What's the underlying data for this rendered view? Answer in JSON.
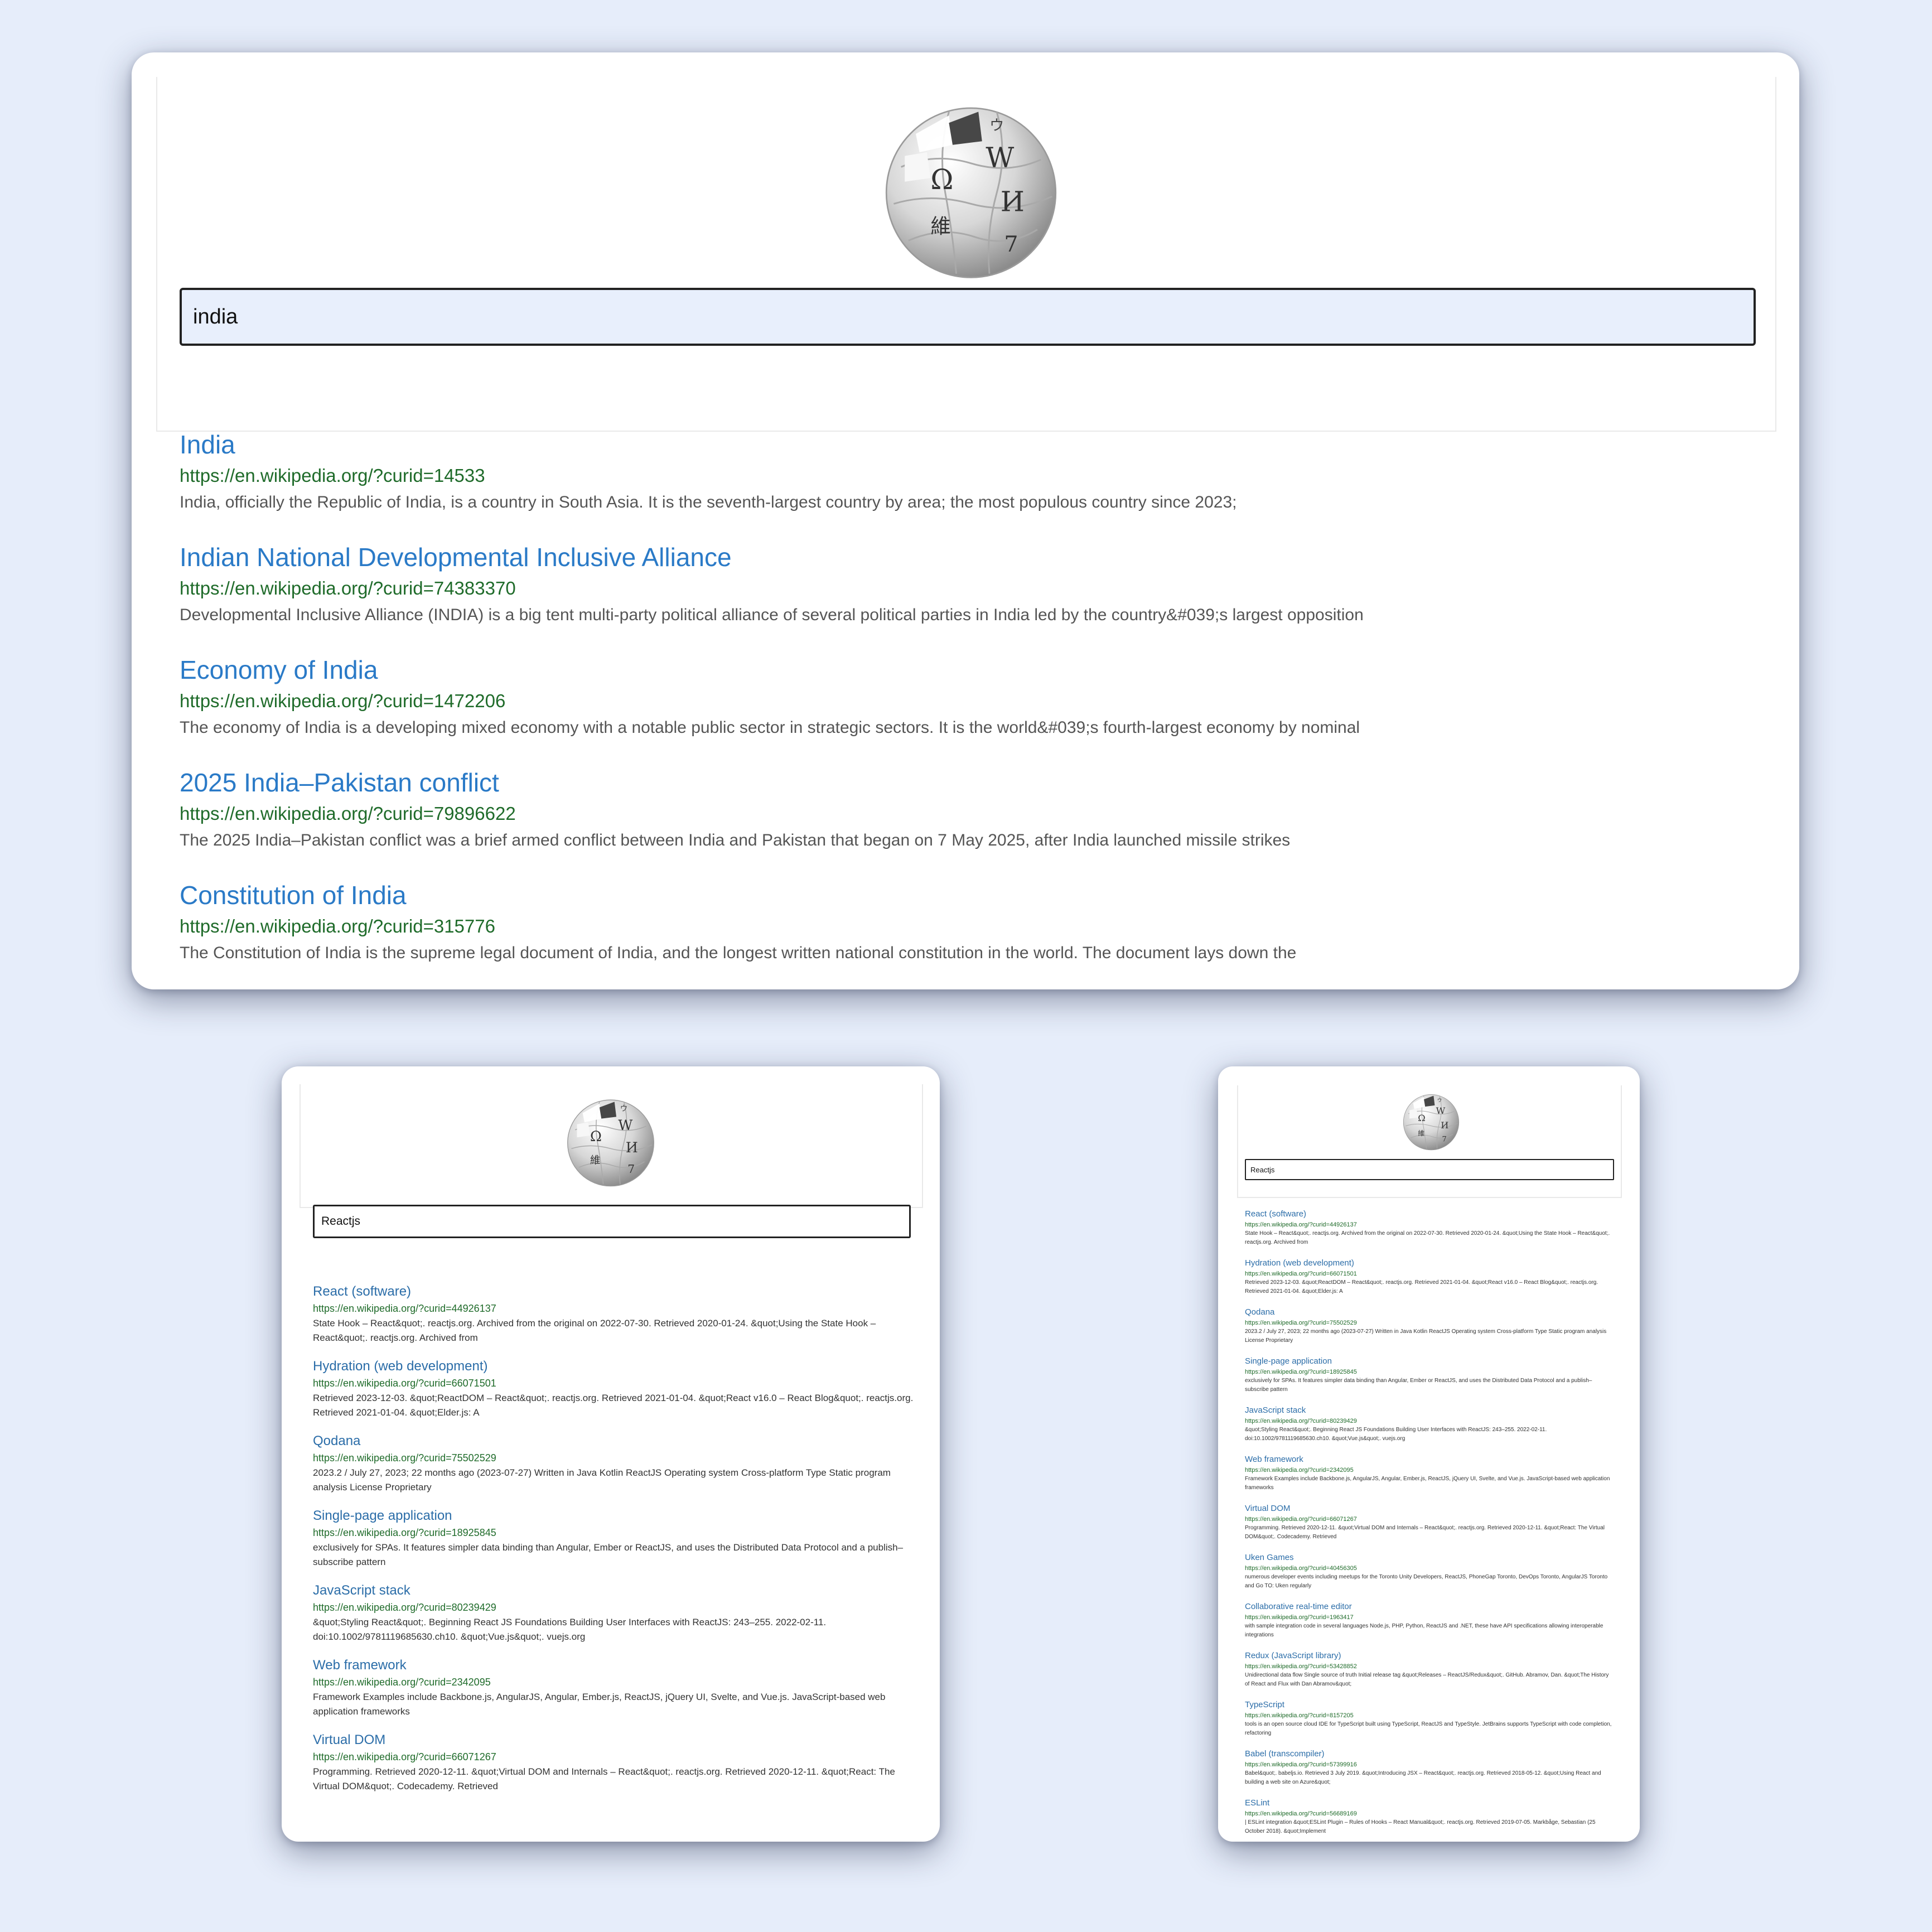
{
  "colors": {
    "background": "#e6edfa",
    "title_link": "#2a7ac7",
    "url": "#1f6b2a",
    "snippet": "#555555",
    "search_bg": "#e8effc"
  },
  "logo_icon": "wikipedia-globe-icon",
  "desktop": {
    "search_value": "india",
    "results": [
      {
        "title": "India",
        "url": "https://en.wikipedia.org/?curid=14533",
        "snippet": "India, officially the Republic of India, is a country in South Asia. It is the seventh-largest country by area; the most populous country since 2023;"
      },
      {
        "title": "Indian National Developmental Inclusive Alliance",
        "url": "https://en.wikipedia.org/?curid=74383370",
        "snippet": "Developmental Inclusive Alliance (INDIA) is a big tent multi-party political alliance of several political parties in India led by the country&#039;s largest opposition"
      },
      {
        "title": "Economy of India",
        "url": "https://en.wikipedia.org/?curid=1472206",
        "snippet": "The economy of India is a developing mixed economy with a notable public sector in strategic sectors. It is the world&#039;s fourth-largest economy by nominal"
      },
      {
        "title": "2025 India–Pakistan conflict",
        "url": "https://en.wikipedia.org/?curid=79896622",
        "snippet": "The 2025 India–Pakistan conflict was a brief armed conflict between India and Pakistan that began on 7 May 2025, after India launched missile strikes"
      },
      {
        "title": "Constitution of India",
        "url": "https://en.wikipedia.org/?curid=315776",
        "snippet": "The Constitution of India is the supreme legal document of India, and the longest written national constitution in the world. The document lays down the"
      }
    ]
  },
  "tablet": {
    "search_value": "Reactjs",
    "results": [
      {
        "title": "React (software)",
        "url": "https://en.wikipedia.org/?curid=44926137",
        "snippet": "State Hook – React&quot;. reactjs.org. Archived from the original on 2022-07-30. Retrieved 2020-01-24. &quot;Using the State Hook – React&quot;. reactjs.org. Archived from"
      },
      {
        "title": "Hydration (web development)",
        "url": "https://en.wikipedia.org/?curid=66071501",
        "snippet": "Retrieved 2023-12-03. &quot;ReactDOM – React&quot;. reactjs.org. Retrieved 2021-01-04. &quot;React v16.0 – React Blog&quot;. reactjs.org. Retrieved 2021-01-04. &quot;Elder.js: A"
      },
      {
        "title": "Qodana",
        "url": "https://en.wikipedia.org/?curid=75502529",
        "snippet": "2023.2 / July 27, 2023; 22 months ago (2023-07-27) Written in Java Kotlin ReactJS Operating system Cross-platform Type Static program analysis License Proprietary"
      },
      {
        "title": "Single-page application",
        "url": "https://en.wikipedia.org/?curid=18925845",
        "snippet": "exclusively for SPAs. It features simpler data binding than Angular, Ember or ReactJS, and uses the Distributed Data Protocol and a publish–subscribe pattern"
      },
      {
        "title": "JavaScript stack",
        "url": "https://en.wikipedia.org/?curid=80239429",
        "snippet": "&quot;Styling React&quot;. Beginning React JS Foundations Building User Interfaces with ReactJS: 243–255. 2022-02-11. doi:10.1002/9781119685630.ch10. &quot;Vue.js&quot;. vuejs.org"
      },
      {
        "title": "Web framework",
        "url": "https://en.wikipedia.org/?curid=2342095",
        "snippet": "Framework Examples include Backbone.js, AngularJS, Angular, Ember.js, ReactJS, jQuery UI, Svelte, and Vue.js. JavaScript-based web application frameworks"
      },
      {
        "title": "Virtual DOM",
        "url": "https://en.wikipedia.org/?curid=66071267",
        "snippet": "Programming. Retrieved 2020-12-11. &quot;Virtual DOM and Internals – React&quot;. reactjs.org. Retrieved 2020-12-11. &quot;React: The Virtual DOM&quot;. Codecademy. Retrieved"
      }
    ]
  },
  "mobile": {
    "search_value": "Reactjs",
    "results": [
      {
        "title": "React (software)",
        "url": "https://en.wikipedia.org/?curid=44926137",
        "snippet": "State Hook – React&quot;. reactjs.org. Archived from the original on 2022-07-30. Retrieved 2020-01-24. &quot;Using the State Hook – React&quot;. reactjs.org. Archived from"
      },
      {
        "title": "Hydration (web development)",
        "url": "https://en.wikipedia.org/?curid=66071501",
        "snippet": "Retrieved 2023-12-03. &quot;ReactDOM – React&quot;. reactjs.org. Retrieved 2021-01-04. &quot;React v16.0 – React Blog&quot;. reactjs.org. Retrieved 2021-01-04. &quot;Elder.js: A"
      },
      {
        "title": "Qodana",
        "url": "https://en.wikipedia.org/?curid=75502529",
        "snippet": "2023.2 / July 27, 2023; 22 months ago (2023-07-27) Written in Java Kotlin ReactJS Operating system Cross-platform Type Static program analysis License Proprietary"
      },
      {
        "title": "Single-page application",
        "url": "https://en.wikipedia.org/?curid=18925845",
        "snippet": "exclusively for SPAs. It features simpler data binding than Angular, Ember or ReactJS, and uses the Distributed Data Protocol and a publish–subscribe pattern"
      },
      {
        "title": "JavaScript stack",
        "url": "https://en.wikipedia.org/?curid=80239429",
        "snippet": "&quot;Styling React&quot;. Beginning React JS Foundations Building User Interfaces with ReactJS: 243–255. 2022-02-11. doi:10.1002/9781119685630.ch10. &quot;Vue.js&quot;. vuejs.org"
      },
      {
        "title": "Web framework",
        "url": "https://en.wikipedia.org/?curid=2342095",
        "snippet": "Framework Examples include Backbone.js, AngularJS, Angular, Ember.js, ReactJS, jQuery UI, Svelte, and Vue.js. JavaScript-based web application frameworks"
      },
      {
        "title": "Virtual DOM",
        "url": "https://en.wikipedia.org/?curid=66071267",
        "snippet": "Programming. Retrieved 2020-12-11. &quot;Virtual DOM and Internals – React&quot;. reactjs.org. Retrieved 2020-12-11. &quot;React: The Virtual DOM&quot;. Codecademy. Retrieved"
      },
      {
        "title": "Uken Games",
        "url": "https://en.wikipedia.org/?curid=40456305",
        "snippet": "numerous developer events including meetups for the Toronto Unity Developers, ReactJS, PhoneGap Toronto, DevOps Toronto, AngularJS Toronto and Go TO: Uken regularly"
      },
      {
        "title": "Collaborative real-time editor",
        "url": "https://en.wikipedia.org/?curid=1963417",
        "snippet": "with sample integration code in several languages Node.js, PHP, Python, ReactJS and .NET, these have API specifications allowing interoperable integrations"
      },
      {
        "title": "Redux (JavaScript library)",
        "url": "https://en.wikipedia.org/?curid=53428852",
        "snippet": "Unidirectional data flow Single source of truth Initial release tag &quot;Releases – ReactJS/Redux&quot;. GitHub. Abramov, Dan. &quot;The History of React and Flux with Dan Abramov&quot;"
      },
      {
        "title": "TypeScript",
        "url": "https://en.wikipedia.org/?curid=8157205",
        "snippet": "tools is an open source cloud IDE for TypeScript built using TypeScript, ReactJS and TypeStyle. JetBrains supports TypeScript with code completion, refactoring"
      },
      {
        "title": "Babel (transcompiler)",
        "url": "https://en.wikipedia.org/?curid=57399916",
        "snippet": "Babel&quot;. babeljs.io. Retrieved 3 July 2019. &quot;Introducing JSX – React&quot;. reactjs.org. Retrieved 2018-05-12. &quot;Using React and building a web site on Azure&quot;"
      },
      {
        "title": "ESLint",
        "url": "https://en.wikipedia.org/?curid=56689169",
        "snippet": "| ESLint integration &quot;ESLint Plugin – Rules of Hooks – React Manual&quot;. reactjs.org. Retrieved 2019-07-05. Markbåge, Sebastian (25 October 2018). &quot;Implement"
      }
    ]
  }
}
